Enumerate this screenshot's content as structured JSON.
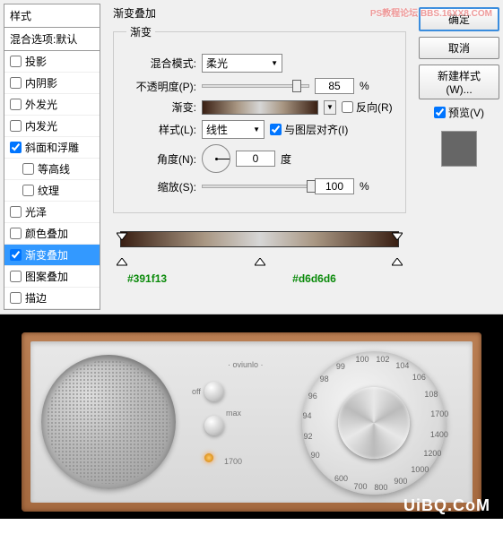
{
  "styleList": {
    "header": "样式",
    "subheader": "混合选项:默认",
    "items": [
      {
        "label": "投影",
        "checked": false
      },
      {
        "label": "内阴影",
        "checked": false
      },
      {
        "label": "外发光",
        "checked": false
      },
      {
        "label": "内发光",
        "checked": false
      },
      {
        "label": "斜面和浮雕",
        "checked": true
      },
      {
        "label": "等高线",
        "checked": false,
        "indent": true
      },
      {
        "label": "纹理",
        "checked": false,
        "indent": true
      },
      {
        "label": "光泽",
        "checked": false
      },
      {
        "label": "颜色叠加",
        "checked": false
      },
      {
        "label": "渐变叠加",
        "checked": true,
        "selected": true
      },
      {
        "label": "图案叠加",
        "checked": false
      },
      {
        "label": "描边",
        "checked": false
      }
    ]
  },
  "center": {
    "title": "渐变叠加",
    "groupTitle": "渐变",
    "blendModeLabel": "混合模式:",
    "blendModeValue": "柔光",
    "opacityLabel": "不透明度(P):",
    "opacityValue": "85",
    "opacityUnit": "%",
    "gradientLabel": "渐变:",
    "reverseLabel": "反向(R)",
    "styleLabel": "样式(L):",
    "styleValue": "线性",
    "alignLabel": "与图层对齐(I)",
    "angleLabel": "角度(N):",
    "angleValue": "0",
    "angleUnit": "度",
    "scaleLabel": "缩放(S):",
    "scaleValue": "100",
    "scaleUnit": "%"
  },
  "buttons": {
    "ok": "确定",
    "cancel": "取消",
    "newStyle": "新建样式(W)...",
    "preview": "预览(V)"
  },
  "colors": {
    "left": "#391f13",
    "mid": "#d6d6d6"
  },
  "radio": {
    "brand": "· oviunlo ·",
    "off": "off",
    "max": "max",
    "nums": [
      "90",
      "92",
      "94",
      "96",
      "98",
      "99",
      "100",
      "102",
      "104",
      "106",
      "108",
      "1700",
      "1400",
      "1200",
      "1000",
      "900",
      "800",
      "700",
      "600"
    ]
  },
  "watermark": {
    "top": "PS教程论坛\nBBS.16XX8.COM",
    "bottom": "UiBQ.CoM"
  }
}
